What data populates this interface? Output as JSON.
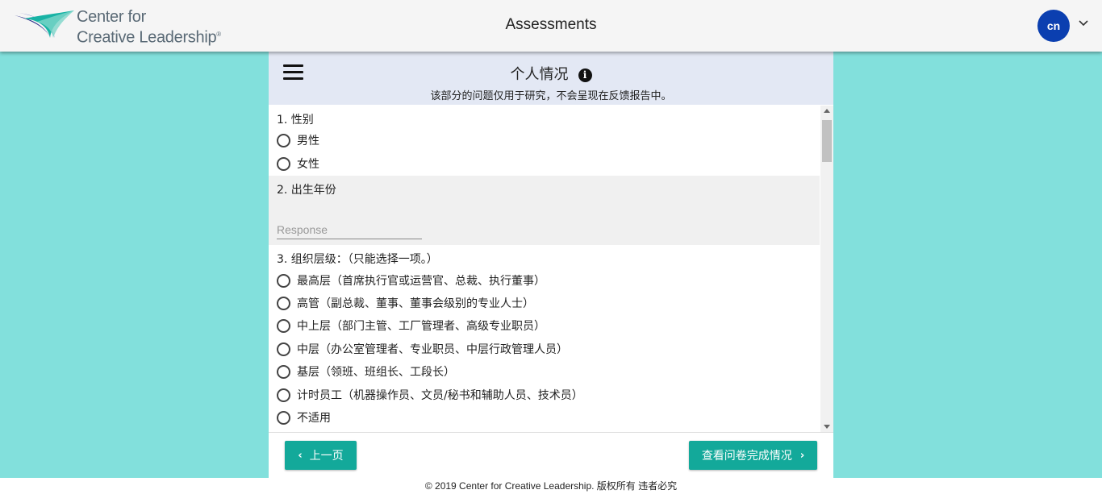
{
  "header": {
    "logo_line1": "Center for",
    "logo_line2": "Creative Leadership",
    "logo_tm": "®",
    "title": "Assessments",
    "user_initials": "cn",
    "logo_icon": "ccl-swoosh-logo",
    "menu_icon": "chevron-down-icon"
  },
  "section": {
    "title": "个人情况",
    "subtitle": "该部分的问题仅用于研究，不会呈现在反馈报告中。",
    "info_icon": "i"
  },
  "questions": [
    {
      "label": "1. 性别",
      "options": [
        "男性",
        "女性"
      ]
    },
    {
      "label": "2. 出生年份",
      "placeholder": "Response",
      "value": ""
    },
    {
      "label": "3. 组织层级：（只能选择一项。）",
      "options": [
        "最高层（首席执行官或运营官、总裁、执行董事）",
        "高管（副总裁、董事、董事会级别的专业人士）",
        "中上层（部门主管、工厂管理者、高级专业职员）",
        "中层（办公室管理者、专业职员、中层行政管理人员）",
        "基层（领班、班组长、工段长）",
        "计时员工（机器操作员、文员/秘书和辅助人员、技术员）",
        "不适用"
      ]
    }
  ],
  "nav": {
    "prev_label": "上一页",
    "next_label": "查看问卷完成情况",
    "prev_icon": "‹",
    "next_icon": "›"
  },
  "footer": {
    "text": "© 2019 Center for Creative Leadership. 版权所有 违者必究"
  },
  "colors": {
    "background": "#82e0dc",
    "header_bg": "#e3e8f4",
    "button": "#13a99a",
    "avatar": "#0b3fb0"
  }
}
